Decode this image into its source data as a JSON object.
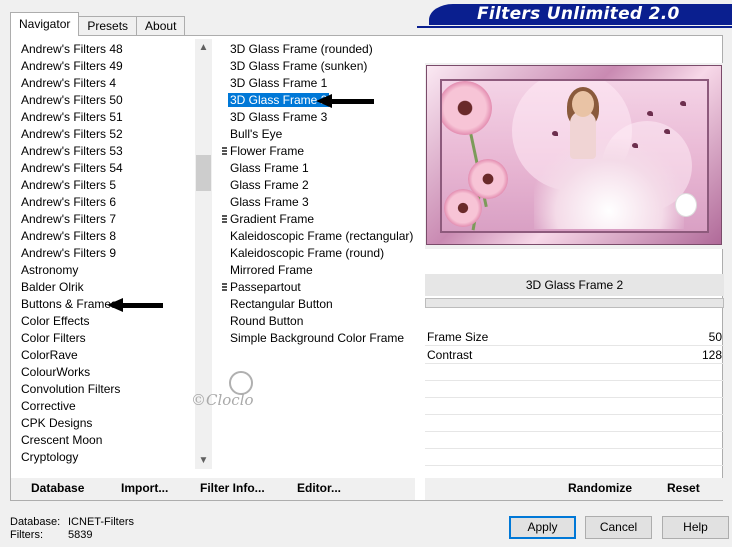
{
  "tabs": [
    "Navigator",
    "Presets",
    "About"
  ],
  "banner_title": "Filters Unlimited 2.0",
  "categories": [
    "Andrew's Filters 48",
    "Andrew's Filters 49",
    "Andrew's Filters 4",
    "Andrew's Filters 50",
    "Andrew's Filters 51",
    "Andrew's Filters 52",
    "Andrew's Filters 53",
    "Andrew's Filters 54",
    "Andrew's Filters 5",
    "Andrew's Filters 6",
    "Andrew's Filters 7",
    "Andrew's Filters 8",
    "Andrew's Filters 9",
    "Astronomy",
    "Balder Olrik",
    "Buttons & Frames",
    "Color Effects",
    "Color Filters",
    "ColorRave",
    "ColourWorks",
    "Convolution Filters",
    "Corrective",
    "CPK Designs",
    "Crescent Moon",
    "Cryptology"
  ],
  "filters": [
    "3D Glass Frame (rounded)",
    "3D Glass Frame (sunken)",
    "3D Glass Frame 1",
    "3D Glass Frame 2",
    "3D Glass Frame 3",
    "Bull's Eye",
    "Flower Frame",
    "Glass Frame 1",
    "Glass Frame 2",
    "Glass Frame 3",
    "Gradient Frame",
    "Kaleidoscopic Frame (rectangular)",
    "Kaleidoscopic Frame (round)",
    "Mirrored Frame",
    "Passepartout",
    "Rectangular Button",
    "Round Button",
    "Simple Background Color Frame"
  ],
  "selected_filter_name": "3D Glass Frame 2",
  "sliders": [
    {
      "label": "Frame Size",
      "value": "50"
    },
    {
      "label": "Contrast",
      "value": "128"
    }
  ],
  "toolbar": {
    "database": "Database",
    "import": "Import...",
    "filter_info": "Filter Info...",
    "editor": "Editor...",
    "randomize": "Randomize",
    "reset": "Reset"
  },
  "footer": {
    "database_label": "Database:",
    "database_value": "ICNET-Filters",
    "filters_label": "Filters:",
    "filters_value": "5839"
  },
  "buttons": {
    "apply": "Apply",
    "cancel": "Cancel",
    "help": "Help"
  },
  "watermark": "©Cloclo"
}
